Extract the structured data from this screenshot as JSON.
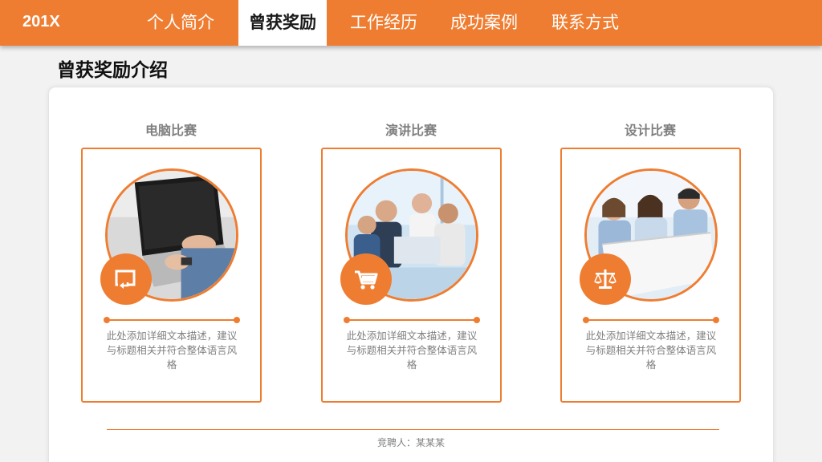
{
  "header": {
    "brand": "201X",
    "nav": [
      {
        "label": "个人简介",
        "active": false
      },
      {
        "label": "曾获奖励",
        "active": true
      },
      {
        "label": "工作经历",
        "active": false
      },
      {
        "label": "成功案例",
        "active": false
      },
      {
        "label": "联系方式",
        "active": false
      }
    ]
  },
  "section_title": "曾获奖励介绍",
  "cards": [
    {
      "title": "电脑比赛",
      "icon": "refresh-arrow-icon",
      "image": "laptop-typing-photo",
      "desc": "此处添加详细文本描述，建议与标题相关并符合整体语言风格"
    },
    {
      "title": "演讲比赛",
      "icon": "shopping-cart-icon",
      "image": "business-team-photo",
      "desc": "此处添加详细文本描述，建议与标题相关并符合整体语言风格"
    },
    {
      "title": "设计比赛",
      "icon": "balance-scale-icon",
      "image": "team-with-blueprint-photo",
      "desc": "此处添加详细文本描述，建议与标题相关并符合整体语言风格"
    }
  ],
  "footer": "竞聘人：某某某",
  "colors": {
    "accent": "#ef7d31",
    "muted_text": "#7f7f7f",
    "background": "#f2f2f2"
  }
}
